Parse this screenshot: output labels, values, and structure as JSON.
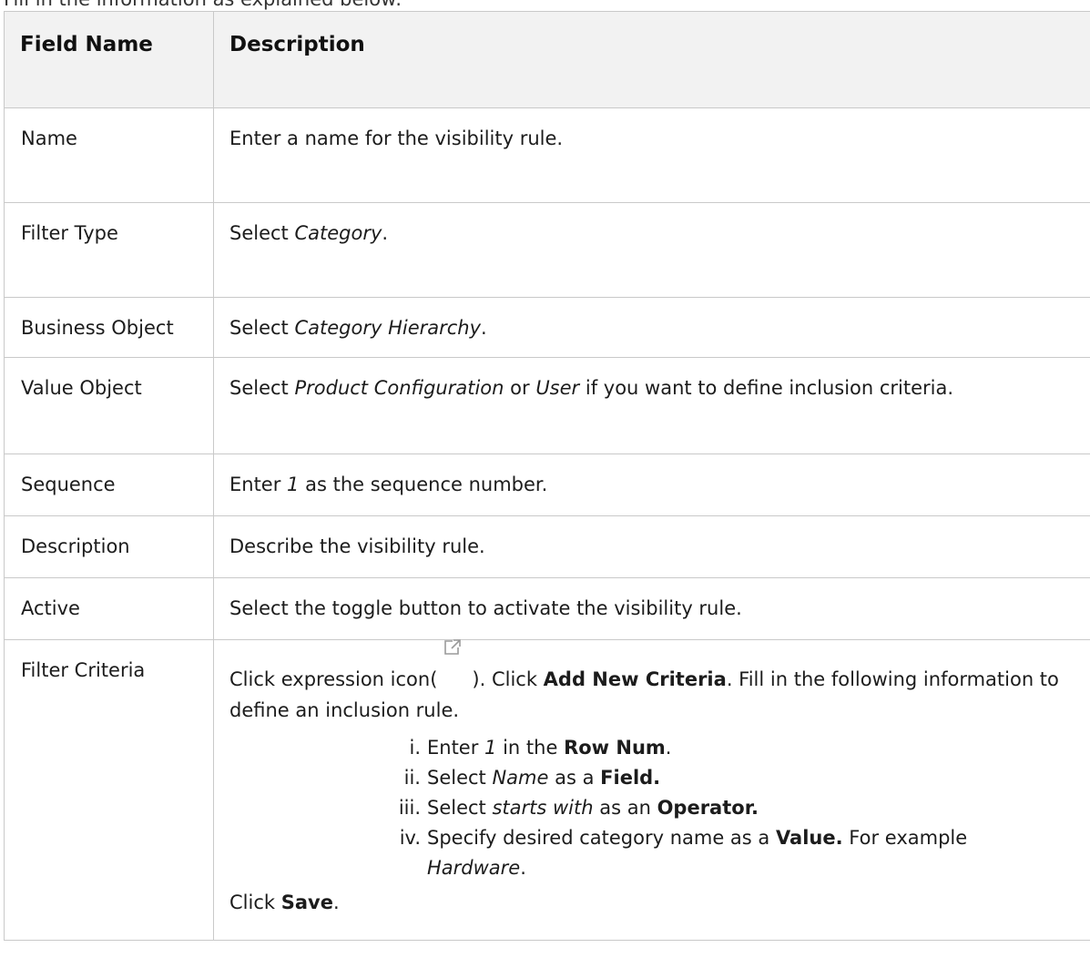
{
  "intro": "Fill in the information as explained below:",
  "table": {
    "headers": [
      "Field Name",
      "Description"
    ],
    "rows": {
      "name": {
        "field": "Name",
        "desc": "Enter a name for the visibility rule."
      },
      "filter_type": {
        "field": "Filter Type",
        "desc_pre": "Select ",
        "desc_em": "Category",
        "desc_post": "."
      },
      "business_object": {
        "field": "Business Object",
        "desc_pre": "Select ",
        "desc_em": "Category Hierarchy",
        "desc_post": "."
      },
      "value_object": {
        "field": "Value Object",
        "desc_pre": "Select ",
        "desc_em1": "Product Configuration",
        "desc_mid": " or ",
        "desc_em2": "User",
        "desc_post": " if you want to define inclusion criteria."
      },
      "sequence": {
        "field": "Sequence",
        "desc_pre": "Enter ",
        "desc_em": "1",
        "desc_post": " as the sequence number."
      },
      "description": {
        "field": "Description",
        "desc": "Describe the visibility rule."
      },
      "active": {
        "field": "Active",
        "desc": "Select the toggle button to activate the visibility rule."
      },
      "filter_criteria": {
        "field": "Filter Criteria",
        "p1_pre": "Click expression icon(",
        "p1_icon": "external-link-icon",
        "p1_mid": "). Click ",
        "p1_bold": "Add New Criteria",
        "p1_post": ". Fill in the following information to define an inclusion rule.",
        "steps": [
          {
            "num": "i.",
            "pre": "Enter ",
            "em": "1",
            "mid": " in the ",
            "bold": "Row Num",
            "post": "."
          },
          {
            "num": "ii.",
            "pre": "Select ",
            "em": "Name",
            "mid": " as a ",
            "bold": "Field.",
            "post": ""
          },
          {
            "num": "iii.",
            "pre": "Select ",
            "em": "starts with",
            "mid": " as an ",
            "bold": "Operator.",
            "post": ""
          },
          {
            "num": "iv.",
            "pre": "Specify desired category name as a ",
            "bold": "Value.",
            "mid": " For example",
            "em": "Hardware",
            "post": "."
          }
        ],
        "p2_pre": "Click ",
        "p2_bold": "Save",
        "p2_post": "."
      }
    }
  },
  "colors": {
    "border": "#c9c9c9",
    "header_bg": "#f2f2f2",
    "text": "#1c1c1c",
    "icon": "#9a9a9a"
  }
}
